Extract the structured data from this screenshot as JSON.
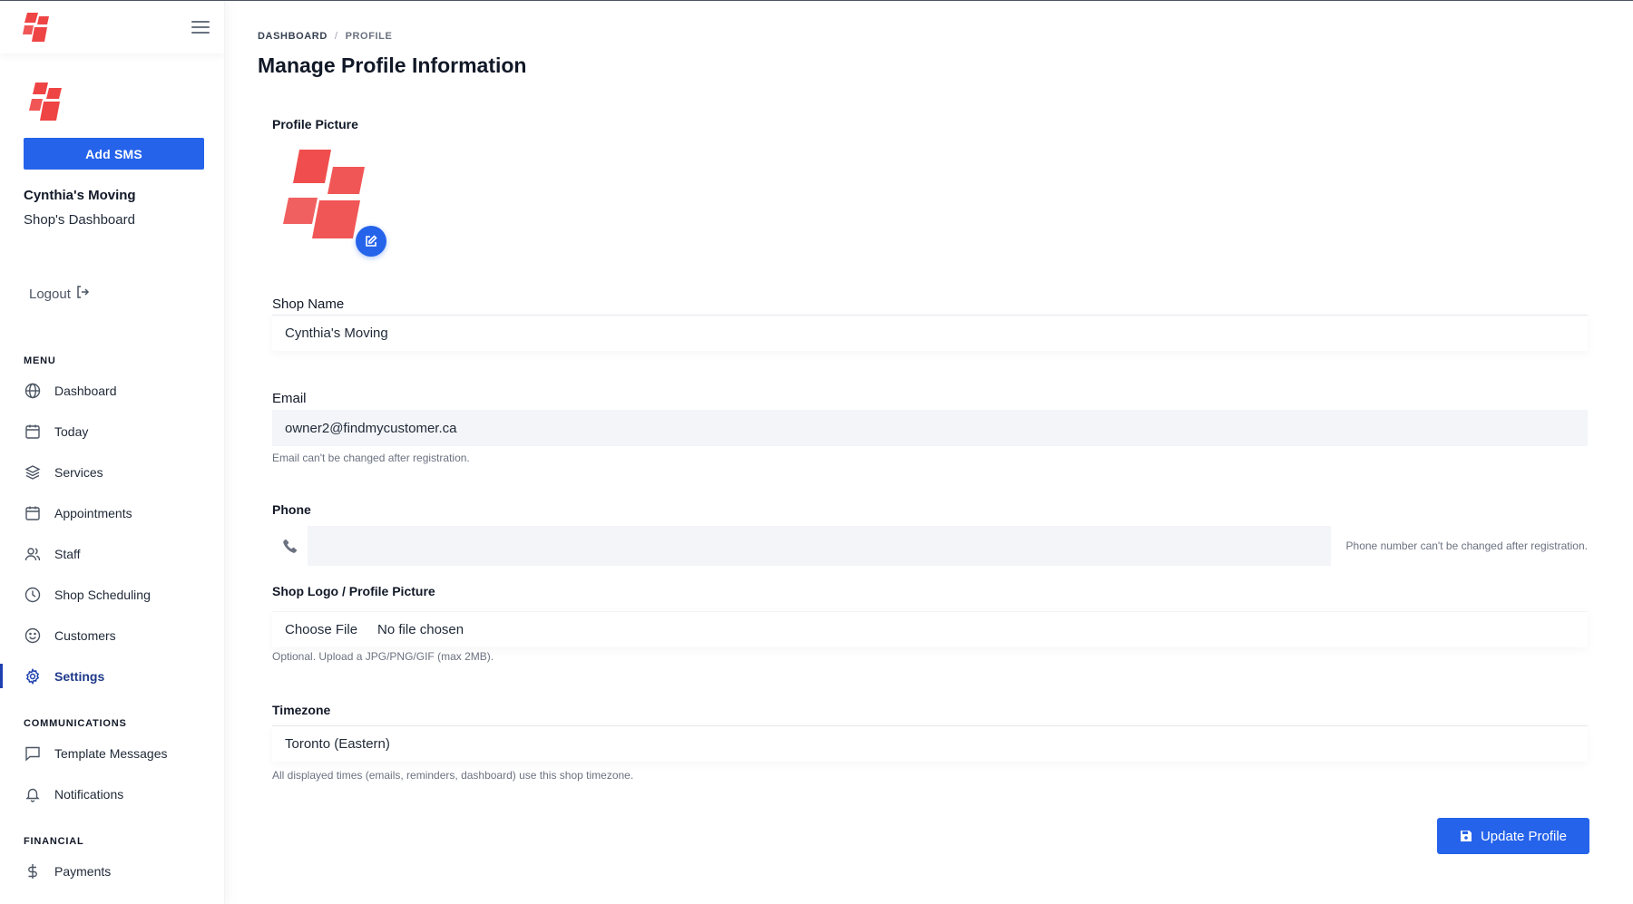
{
  "sidebar": {
    "add_sms_label": "Add SMS",
    "shop_name": "Cynthia's Moving",
    "shop_dashboard": "Shop's Dashboard",
    "logout_label": "Logout",
    "menu_label": "MENU",
    "menu_items": [
      {
        "label": "Dashboard",
        "icon": "globe-icon"
      },
      {
        "label": "Today",
        "icon": "calendar-icon"
      },
      {
        "label": "Services",
        "icon": "layers-icon"
      },
      {
        "label": "Appointments",
        "icon": "calendar-icon"
      },
      {
        "label": "Staff",
        "icon": "users-icon"
      },
      {
        "label": "Shop Scheduling",
        "icon": "clock-icon"
      },
      {
        "label": "Customers",
        "icon": "smile-icon"
      },
      {
        "label": "Settings",
        "icon": "gear-icon",
        "active": true
      }
    ],
    "communications_label": "COMMUNICATIONS",
    "communications_items": [
      {
        "label": "Template Messages",
        "icon": "message-icon"
      },
      {
        "label": "Notifications",
        "icon": "bell-icon"
      }
    ],
    "financial_label": "FINANCIAL",
    "financial_items": [
      {
        "label": "Payments",
        "icon": "dollar-icon"
      }
    ]
  },
  "breadcrumb": {
    "home": "DASHBOARD",
    "separator": "/",
    "current": "PROFILE"
  },
  "page_title": "Manage Profile Information",
  "form": {
    "profile_picture_label": "Profile Picture",
    "shop_name_label": "Shop Name",
    "shop_name_value": "Cynthia's Moving",
    "email_label": "Email",
    "email_value": "owner2@findmycustomer.ca",
    "email_help": "Email can't be changed after registration.",
    "phone_label": "Phone",
    "phone_value": "",
    "phone_help": "Phone number can't be changed after registration.",
    "logo_label": "Shop Logo / Profile Picture",
    "choose_file_label": "Choose File",
    "no_file_label": "No file chosen",
    "logo_help": "Optional. Upload a JPG/PNG/GIF (max 2MB).",
    "timezone_label": "Timezone",
    "timezone_value": "Toronto (Eastern)",
    "timezone_help": "All displayed times (emails, reminders, dashboard) use this shop timezone.",
    "update_label": "Update Profile"
  },
  "colors": {
    "primary": "#2563eb",
    "brand_red": "#ef4444",
    "active_nav": "#1e3a8a"
  }
}
